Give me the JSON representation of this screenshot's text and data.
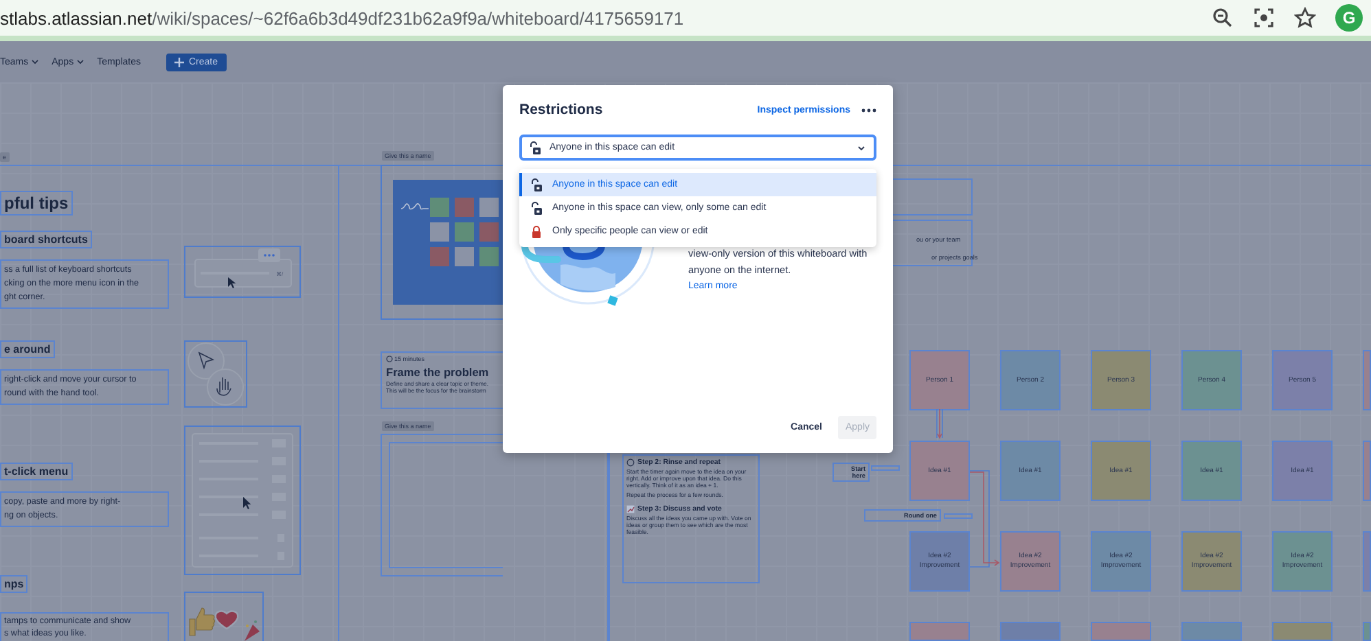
{
  "browser": {
    "url_host": "stlabs.atlassian.net",
    "url_path": "/wiki/spaces/~62f6a6b3d49df231b62a9f9a/whiteboard/4175659171",
    "avatar": "G"
  },
  "nav": {
    "items": [
      {
        "label": "Teams",
        "dropdown": true
      },
      {
        "label": "Apps",
        "dropdown": true
      },
      {
        "label": "Templates",
        "dropdown": false
      }
    ],
    "create": "Create"
  },
  "board": {
    "frame_labels": [
      "e",
      "Give this a name",
      "Give this a name"
    ],
    "tips": {
      "title": "pful tips",
      "shortcut_hint": "⌘/",
      "sections": [
        {
          "heading": "board shortcuts",
          "lines": [
            "ss a full list of keyboard shortcuts",
            "cking on the more menu icon in the",
            "ght corner."
          ]
        },
        {
          "heading": "e around",
          "lines": [
            "right-click and move your cursor to",
            "round with the hand tool."
          ]
        },
        {
          "heading": "t-click menu",
          "lines": [
            "copy, paste and more by right-",
            "ng on objects."
          ]
        },
        {
          "heading": "nps",
          "lines": [
            "tamps to communicate and show",
            "s what ideas you like."
          ]
        }
      ]
    },
    "problem": {
      "duration": "15 minutes",
      "title": "Frame the problem",
      "lines": [
        "Define and share a clear topic or theme.",
        "This will be the focus for the brainstorm"
      ]
    },
    "steps": [
      {
        "title": "Step 2: Rinse and repeat",
        "paragraphs": [
          "Start the timer again move to the idea on your right. Add or improve upon that idea. Do this vertically. Think of it as an idea + 1.",
          "Repeat the process for a few rounds."
        ]
      },
      {
        "title": "Step 3: Discuss and vote",
        "paragraphs": [
          "Discuss all the ideas you came up with. Vote on ideas or group them to see which are the most feasible."
        ]
      }
    ],
    "goals_lines": [
      "ou or your team",
      "or projects goals"
    ],
    "markers": [
      "Start here",
      "Round one"
    ],
    "stickies": [
      [
        {
          "text": "Person 1",
          "color": "#98818f"
        },
        {
          "text": "Person 2",
          "color": "#6d8aa6"
        },
        {
          "text": "Person 3",
          "color": "#8b8a72"
        },
        {
          "text": "Person 4",
          "color": "#6c9191"
        },
        {
          "text": "Person 5",
          "color": "#7c80a9"
        },
        {
          "color": "#98818f"
        }
      ],
      [
        {
          "text": "Idea #1",
          "color": "#98818f"
        },
        {
          "text": "Idea #1",
          "color": "#6d8aa6"
        },
        {
          "text": "Idea #1",
          "color": "#8b8a72"
        },
        {
          "text": "Idea #1",
          "color": "#6c9191"
        },
        {
          "text": "Idea #1",
          "color": "#7c80a9"
        },
        {
          "color": "#98818f"
        }
      ],
      [
        {
          "text": "Idea #2 Improvement",
          "color": "#6e7fa8"
        },
        {
          "text": "Idea #2 Improvement",
          "color": "#98818f"
        },
        {
          "text": "Idea #2 Improvement",
          "color": "#6d8aa6"
        },
        {
          "text": "Idea #2 Improvement",
          "color": "#8b8a72"
        },
        {
          "text": "Idea #2 Improvement",
          "color": "#6c9191"
        },
        {
          "color": "#7c80a9"
        }
      ],
      [
        {
          "color": "#98818f"
        },
        {
          "color": "#6e7fa8"
        },
        {
          "color": "#98818f"
        },
        {
          "color": "#6d8aa6"
        },
        {
          "color": "#8b8a72"
        },
        {
          "color": "#6c9191"
        }
      ]
    ]
  },
  "dialog": {
    "title": "Restrictions",
    "inspect_link": "Inspect permissions",
    "select": {
      "value": "Anyone in this space can edit"
    },
    "options": [
      {
        "label": "Anyone in this space can edit",
        "kind": "open",
        "selected": true
      },
      {
        "label": "Anyone in this space can view, only some can edit",
        "kind": "open",
        "selected": false
      },
      {
        "label": "Only specific people can view or edit",
        "kind": "locked",
        "selected": false
      }
    ],
    "share_lines": [
      "view-only version of this whiteboard with",
      "anyone on the internet."
    ],
    "learn_more": "Learn more",
    "cancel": "Cancel",
    "apply": {
      "label": "Apply",
      "disabled": true
    }
  }
}
